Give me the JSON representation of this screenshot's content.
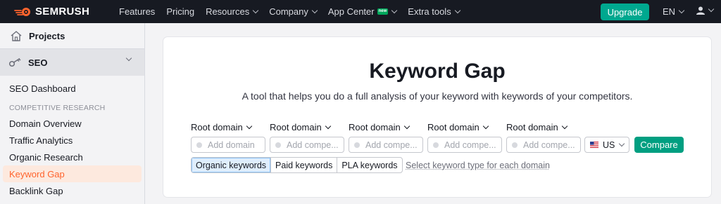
{
  "brand": {
    "name": "SEMRUSH",
    "logo_icon": "semrush-fireball-icon",
    "accent": "#ff642d"
  },
  "nav": {
    "items": [
      {
        "label": "Features",
        "has_dropdown": false
      },
      {
        "label": "Pricing",
        "has_dropdown": false
      },
      {
        "label": "Resources",
        "has_dropdown": true
      },
      {
        "label": "Company",
        "has_dropdown": true
      },
      {
        "label": "App Center",
        "has_dropdown": true,
        "badge": "new"
      },
      {
        "label": "Extra tools",
        "has_dropdown": true
      }
    ],
    "upgrade_label": "Upgrade",
    "language": "EN",
    "user_icon": "user-icon"
  },
  "sidebar": {
    "projects_label": "Projects",
    "seo_label": "SEO",
    "dashboard_label": "SEO Dashboard",
    "section_label": "COMPETITIVE RESEARCH",
    "items": [
      {
        "label": "Domain Overview",
        "active": false
      },
      {
        "label": "Traffic Analytics",
        "active": false
      },
      {
        "label": "Organic Research",
        "active": false
      },
      {
        "label": "Keyword Gap",
        "active": true
      },
      {
        "label": "Backlink Gap",
        "active": false
      }
    ]
  },
  "main": {
    "title": "Keyword Gap",
    "subtitle": "A tool that helps you do a full analysis of your keyword with keywords of your competitors.",
    "domain_type_label": "Root domain",
    "domains": [
      {
        "placeholder": "Add domain"
      },
      {
        "placeholder": "Add compe..."
      },
      {
        "placeholder": "Add compe..."
      },
      {
        "placeholder": "Add compe..."
      },
      {
        "placeholder": "Add compe..."
      }
    ],
    "country": "US",
    "compare_label": "Compare",
    "keyword_types": [
      {
        "label": "Organic keywords",
        "active": true
      },
      {
        "label": "Paid keywords",
        "active": false
      },
      {
        "label": "PLA keywords",
        "active": false
      }
    ],
    "keyword_type_hint": "Select keyword type for each domain"
  },
  "colors": {
    "topbar": "#171a22",
    "primary_button": "#00a88f",
    "active_tab": "#dfeefd",
    "active_sidebar": "#fde9de"
  }
}
